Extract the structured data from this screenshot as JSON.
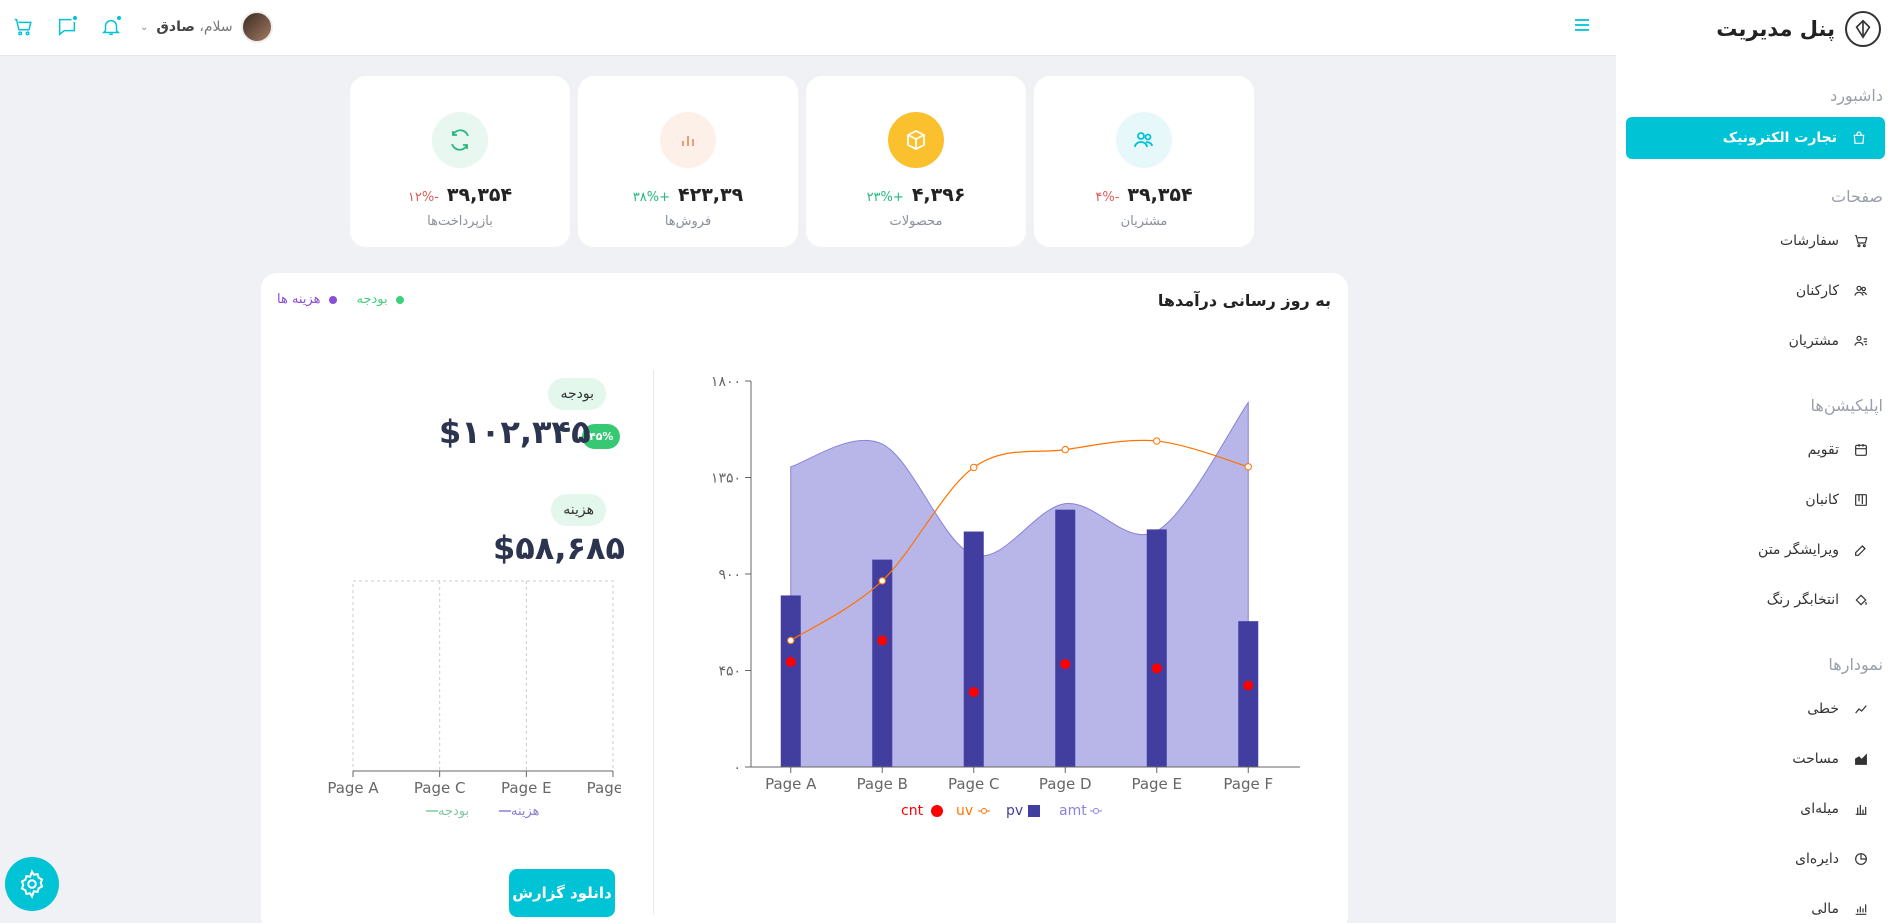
{
  "brand": {
    "title": "پنل مدیریت"
  },
  "sidebar": {
    "sections": [
      {
        "title": "داشبورد",
        "items": [
          {
            "label": "تجارت الکترونیک",
            "icon": "bag-icon",
            "active": true
          }
        ]
      },
      {
        "title": "صفحات",
        "items": [
          {
            "label": "سفارشات",
            "icon": "cart-icon"
          },
          {
            "label": "کارکنان",
            "icon": "users-icon"
          },
          {
            "label": "مشتریان",
            "icon": "user-list-icon"
          }
        ]
      },
      {
        "title": "اپلیکیشن‌ها",
        "items": [
          {
            "label": "تقویم",
            "icon": "calendar-icon"
          },
          {
            "label": "کانبان",
            "icon": "kanban-icon"
          },
          {
            "label": "ویرایشگر متن",
            "icon": "edit-icon"
          },
          {
            "label": "انتخابگر رنگ",
            "icon": "paint-bucket-icon"
          }
        ]
      },
      {
        "title": "نمودارها",
        "items": [
          {
            "label": "خطی",
            "icon": "line-chart-icon"
          },
          {
            "label": "مساحت",
            "icon": "area-chart-icon"
          },
          {
            "label": "میله‌ای",
            "icon": "bar-chart-icon"
          },
          {
            "label": "دایره‌ای",
            "icon": "pie-chart-icon"
          },
          {
            "label": "مالی",
            "icon": "finance-icon"
          }
        ]
      }
    ]
  },
  "topbar": {
    "user": {
      "greeting": "سلام،",
      "name": "صادق"
    }
  },
  "stats": [
    {
      "label": "مشتریان",
      "value": "۳۹,۳۵۴",
      "delta": "-۴%",
      "trend": "neg",
      "icon": "users-icon",
      "color": "#e6f8fa",
      "iconColor": "#00c3d6"
    },
    {
      "label": "محصولات",
      "value": "۴,۳۹۶",
      "delta": "+۲۳%",
      "trend": "pos",
      "icon": "box-icon",
      "color": "#fbc02d",
      "iconColor": "#ffffff"
    },
    {
      "label": "فروش‌ها",
      "value": "۴۲۳,۳۹",
      "delta": "+۳۸%",
      "trend": "pos",
      "icon": "bars-icon",
      "color": "#fdf0e8",
      "iconColor": "#e8956b"
    },
    {
      "label": "بازپرداخت‌ها",
      "value": "۳۹,۳۵۴",
      "delta": "-۱۲%",
      "trend": "neg",
      "icon": "refresh-icon",
      "color": "#e8f7ef",
      "iconColor": "#26b87e"
    }
  ],
  "revenue": {
    "title": "به روز رسانی درآمدها",
    "legend": [
      {
        "label": "هزینه ها",
        "color": "#8a4ed8"
      },
      {
        "label": "بودجه",
        "color": "#3ecf7a"
      }
    ],
    "budget": {
      "label": "بودجه",
      "amount": "$۱۰۲,۳۴۵",
      "percent": "۴۵%"
    },
    "expense": {
      "label": "هزینه",
      "amount": "$۵۸,۶۸۵"
    },
    "download_label": "دانلود گزارش"
  },
  "chart_data": [
    {
      "type": "bar",
      "categories": [
        "Page A",
        "Page C",
        "Page E",
        "Page G"
      ],
      "series": [
        {
          "name": "هزینه",
          "values": [
            0,
            0,
            0,
            0
          ]
        },
        {
          "name": "بودجه",
          "values": [
            0,
            0,
            0,
            0
          ]
        }
      ],
      "legend": [
        "هزینه",
        "بودجه"
      ]
    },
    {
      "type": "bar",
      "categories": [
        "Page A",
        "Page B",
        "Page C",
        "Page D",
        "Page E",
        "Page F"
      ],
      "yticks": [
        "۰",
        "۴۵۰",
        "۹۰۰",
        "۱۳۵۰",
        "۱۸۰۰"
      ],
      "ylim": [
        0,
        1800
      ],
      "series": [
        {
          "name": "amt",
          "type": "area",
          "color": "#8884d8",
          "values": [
            1400,
            1506,
            989,
            1228,
            1100,
            1700
          ]
        },
        {
          "name": "pv",
          "type": "bar",
          "color": "#413ea0",
          "values": [
            800,
            967,
            1098,
            1200,
            1108,
            680
          ]
        },
        {
          "name": "uv",
          "type": "line",
          "color": "#ff7300",
          "values": [
            590,
            868,
            1397,
            1480,
            1520,
            1400
          ]
        },
        {
          "name": "cnt",
          "type": "scatter",
          "color": "#ff0000",
          "values": [
            490,
            590,
            350,
            480,
            460,
            380
          ]
        }
      ],
      "legend": [
        "cnt",
        "uv",
        "pv",
        "amt"
      ]
    }
  ]
}
